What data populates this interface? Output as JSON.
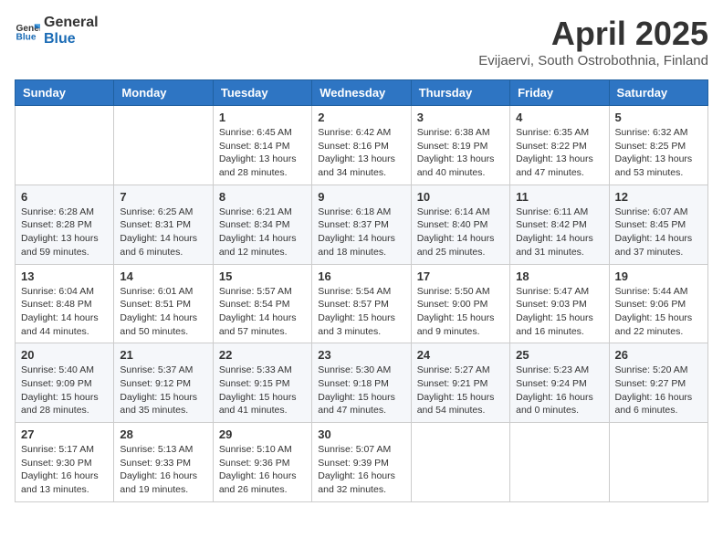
{
  "logo": {
    "line1": "General",
    "line2": "Blue"
  },
  "title": "April 2025",
  "location": "Evijaervi, South Ostrobothnia, Finland",
  "weekdays": [
    "Sunday",
    "Monday",
    "Tuesday",
    "Wednesday",
    "Thursday",
    "Friday",
    "Saturday"
  ],
  "weeks": [
    [
      {
        "day": "",
        "info": ""
      },
      {
        "day": "",
        "info": ""
      },
      {
        "day": "1",
        "info": "Sunrise: 6:45 AM\nSunset: 8:14 PM\nDaylight: 13 hours and 28 minutes."
      },
      {
        "day": "2",
        "info": "Sunrise: 6:42 AM\nSunset: 8:16 PM\nDaylight: 13 hours and 34 minutes."
      },
      {
        "day": "3",
        "info": "Sunrise: 6:38 AM\nSunset: 8:19 PM\nDaylight: 13 hours and 40 minutes."
      },
      {
        "day": "4",
        "info": "Sunrise: 6:35 AM\nSunset: 8:22 PM\nDaylight: 13 hours and 47 minutes."
      },
      {
        "day": "5",
        "info": "Sunrise: 6:32 AM\nSunset: 8:25 PM\nDaylight: 13 hours and 53 minutes."
      }
    ],
    [
      {
        "day": "6",
        "info": "Sunrise: 6:28 AM\nSunset: 8:28 PM\nDaylight: 13 hours and 59 minutes."
      },
      {
        "day": "7",
        "info": "Sunrise: 6:25 AM\nSunset: 8:31 PM\nDaylight: 14 hours and 6 minutes."
      },
      {
        "day": "8",
        "info": "Sunrise: 6:21 AM\nSunset: 8:34 PM\nDaylight: 14 hours and 12 minutes."
      },
      {
        "day": "9",
        "info": "Sunrise: 6:18 AM\nSunset: 8:37 PM\nDaylight: 14 hours and 18 minutes."
      },
      {
        "day": "10",
        "info": "Sunrise: 6:14 AM\nSunset: 8:40 PM\nDaylight: 14 hours and 25 minutes."
      },
      {
        "day": "11",
        "info": "Sunrise: 6:11 AM\nSunset: 8:42 PM\nDaylight: 14 hours and 31 minutes."
      },
      {
        "day": "12",
        "info": "Sunrise: 6:07 AM\nSunset: 8:45 PM\nDaylight: 14 hours and 37 minutes."
      }
    ],
    [
      {
        "day": "13",
        "info": "Sunrise: 6:04 AM\nSunset: 8:48 PM\nDaylight: 14 hours and 44 minutes."
      },
      {
        "day": "14",
        "info": "Sunrise: 6:01 AM\nSunset: 8:51 PM\nDaylight: 14 hours and 50 minutes."
      },
      {
        "day": "15",
        "info": "Sunrise: 5:57 AM\nSunset: 8:54 PM\nDaylight: 14 hours and 57 minutes."
      },
      {
        "day": "16",
        "info": "Sunrise: 5:54 AM\nSunset: 8:57 PM\nDaylight: 15 hours and 3 minutes."
      },
      {
        "day": "17",
        "info": "Sunrise: 5:50 AM\nSunset: 9:00 PM\nDaylight: 15 hours and 9 minutes."
      },
      {
        "day": "18",
        "info": "Sunrise: 5:47 AM\nSunset: 9:03 PM\nDaylight: 15 hours and 16 minutes."
      },
      {
        "day": "19",
        "info": "Sunrise: 5:44 AM\nSunset: 9:06 PM\nDaylight: 15 hours and 22 minutes."
      }
    ],
    [
      {
        "day": "20",
        "info": "Sunrise: 5:40 AM\nSunset: 9:09 PM\nDaylight: 15 hours and 28 minutes."
      },
      {
        "day": "21",
        "info": "Sunrise: 5:37 AM\nSunset: 9:12 PM\nDaylight: 15 hours and 35 minutes."
      },
      {
        "day": "22",
        "info": "Sunrise: 5:33 AM\nSunset: 9:15 PM\nDaylight: 15 hours and 41 minutes."
      },
      {
        "day": "23",
        "info": "Sunrise: 5:30 AM\nSunset: 9:18 PM\nDaylight: 15 hours and 47 minutes."
      },
      {
        "day": "24",
        "info": "Sunrise: 5:27 AM\nSunset: 9:21 PM\nDaylight: 15 hours and 54 minutes."
      },
      {
        "day": "25",
        "info": "Sunrise: 5:23 AM\nSunset: 9:24 PM\nDaylight: 16 hours and 0 minutes."
      },
      {
        "day": "26",
        "info": "Sunrise: 5:20 AM\nSunset: 9:27 PM\nDaylight: 16 hours and 6 minutes."
      }
    ],
    [
      {
        "day": "27",
        "info": "Sunrise: 5:17 AM\nSunset: 9:30 PM\nDaylight: 16 hours and 13 minutes."
      },
      {
        "day": "28",
        "info": "Sunrise: 5:13 AM\nSunset: 9:33 PM\nDaylight: 16 hours and 19 minutes."
      },
      {
        "day": "29",
        "info": "Sunrise: 5:10 AM\nSunset: 9:36 PM\nDaylight: 16 hours and 26 minutes."
      },
      {
        "day": "30",
        "info": "Sunrise: 5:07 AM\nSunset: 9:39 PM\nDaylight: 16 hours and 32 minutes."
      },
      {
        "day": "",
        "info": ""
      },
      {
        "day": "",
        "info": ""
      },
      {
        "day": "",
        "info": ""
      }
    ]
  ]
}
